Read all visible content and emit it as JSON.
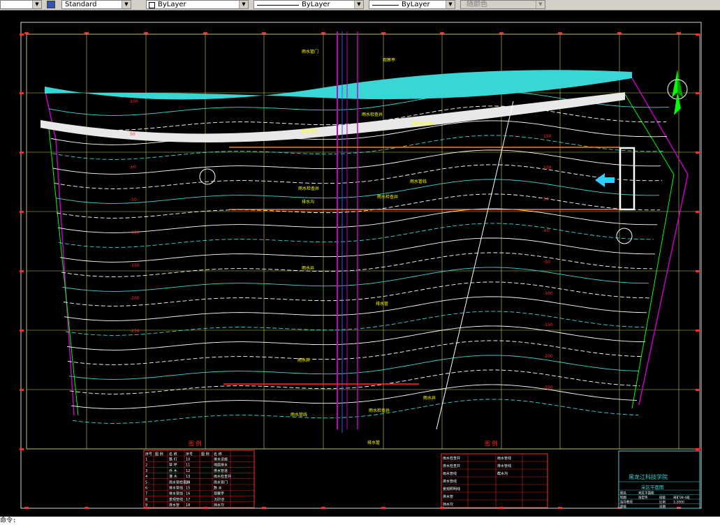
{
  "toolbar": {
    "textstyle_value": "Standard",
    "layer_color_value": "ByLayer",
    "linetype_value": "ByLayer",
    "lineweight_value": "ByLayer",
    "plotstyle_value": "随颜色"
  },
  "drawing": {
    "contour_labels_left": [
      "100",
      "50",
      "±0",
      "-50",
      "-100",
      "-150",
      "-200",
      "-250"
    ],
    "contour_labels_right": [
      "150",
      "100",
      "50",
      "±0",
      "-50",
      "-100",
      "-150",
      "-200",
      "-250"
    ],
    "annotations": [
      "雨水管门",
      "观察亭",
      "雨水检查井",
      "雨水排水管",
      "雨水管门",
      "雨水管线",
      "雨水检查井",
      "雨水检查井",
      "排水沟",
      "雨水井",
      "排水管",
      "雨水井",
      "雨水井",
      "雨水检查井",
      "雨水管线",
      "排水管"
    ],
    "legend_left": {
      "title": "图 例",
      "header": [
        "序号",
        "图 例",
        "名 称",
        "序号",
        "图 例",
        "名 称"
      ],
      "rows": [
        [
          "1",
          "",
          "路 灯",
          "10",
          "",
          "排水设施"
        ],
        [
          "2",
          "",
          "草 坪",
          "11",
          "",
          "地面排水"
        ],
        [
          "3",
          "",
          "乔 木",
          "12",
          "",
          "排水管道"
        ],
        [
          "4",
          "",
          "灌 木",
          "13",
          "",
          "雨水检查井"
        ],
        [
          "5",
          "",
          "雨水管检查井",
          "14",
          "",
          "雨水管门"
        ],
        [
          "6",
          "",
          "排水管线",
          "15",
          "",
          "跌 水"
        ],
        [
          "7",
          "",
          "排水管线",
          "16",
          "",
          "观察亭"
        ],
        [
          "8",
          "",
          "景观管线",
          "17",
          "",
          "沉砂池"
        ],
        [
          "9",
          "",
          "排水管",
          "18",
          "",
          "挡水坎"
        ]
      ]
    },
    "legend_right": {
      "title": "图 例",
      "rows": [
        [
          "雨水检查井",
          "",
          "雨水管线",
          ""
        ],
        [
          "排水检查井",
          "",
          "排水管线",
          ""
        ],
        [
          "雨水管线",
          "",
          "截水沟",
          ""
        ],
        [
          "排水管线",
          "",
          "",
          ""
        ],
        [
          "景观照明线",
          "",
          "",
          ""
        ],
        [
          "排水管",
          "",
          "",
          ""
        ],
        [
          "挡水坎",
          "",
          "",
          ""
        ]
      ]
    },
    "title_block": {
      "school": "黑龙江科技学院",
      "drawing_title": "采区平面图",
      "rows": [
        [
          "图名",
          "采区平面图",
          "",
          ""
        ],
        [
          "制图",
          "张宏伟",
          "班级",
          "采矿08-4班"
        ],
        [
          "指导教师",
          "",
          "比例",
          "1:2000"
        ],
        [
          "审核",
          "",
          "日期",
          ""
        ]
      ]
    }
  },
  "commandline": {
    "text": "命令:"
  },
  "colors": {
    "background": "#000000",
    "contour": "#ffffff",
    "contour_cyan": "#3ad6d6",
    "grid": "#c8d34a",
    "magenta": "#c400c4",
    "orange": "#ff8000",
    "red": "#ff2a2a",
    "green": "#00ff00",
    "yellow": "#ffff00"
  }
}
